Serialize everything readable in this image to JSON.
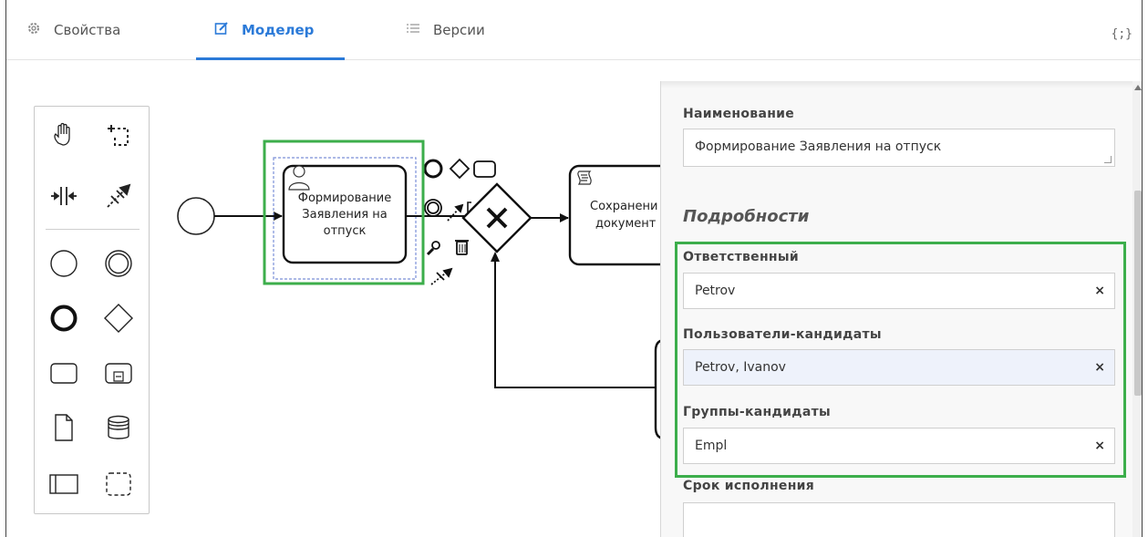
{
  "tabs": [
    {
      "label": "Свойства",
      "icon": "gear-icon",
      "active": false
    },
    {
      "label": "Моделер",
      "icon": "edit-icon",
      "active": true
    },
    {
      "label": "Версии",
      "icon": "list-icon",
      "active": false
    }
  ],
  "json_button": "{;}",
  "diagram": {
    "task1_label_lines": [
      "Формирование",
      "Заявления на",
      "отпуск"
    ],
    "task2_label_lines": [
      "Сохранени",
      "документ"
    ]
  },
  "properties": {
    "name_label": "Наименование",
    "name_value": "Формирование Заявления на отпуск",
    "details_title": "Подробности",
    "assignee_label": "Ответственный",
    "assignee_value": "Petrov",
    "candidate_users_label": "Пользователи-кандидаты",
    "candidate_users_value": "Petrov, Ivanov",
    "candidate_groups_label": "Группы-кандидаты",
    "candidate_groups_value": "Empl",
    "due_date_label": "Срок исполнения",
    "due_date_value": "",
    "clear_symbol": "×"
  },
  "colors": {
    "accent": "#2b7ad8",
    "highlight_green": "#3cae4b",
    "selection_blue": "#7a8fd8"
  }
}
